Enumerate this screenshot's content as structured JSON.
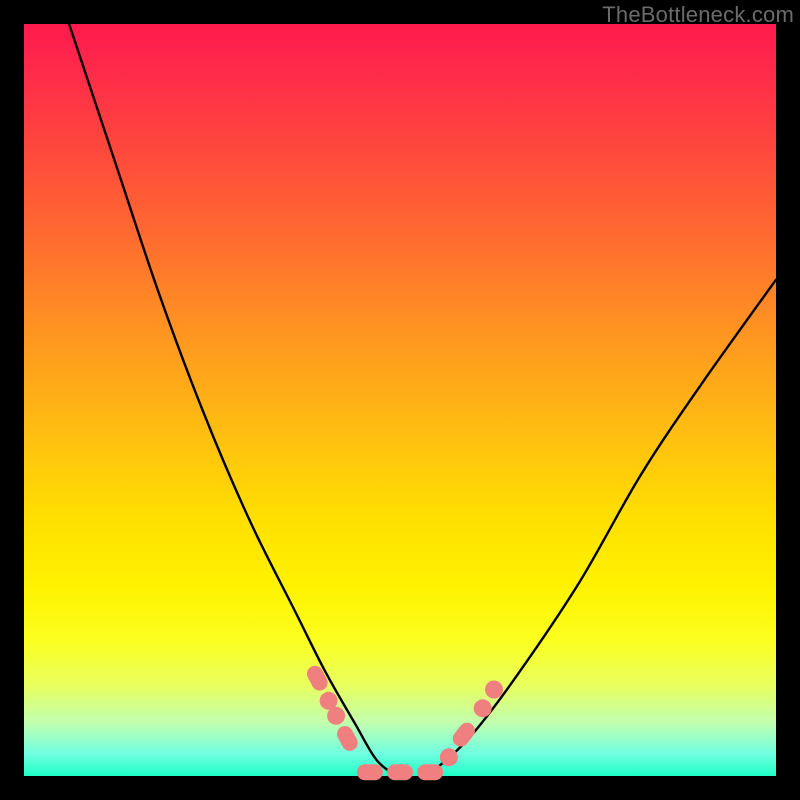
{
  "watermark": "TheBottleneck.com",
  "colors": {
    "background_frame": "#000000",
    "gradient_top": "#ff1a4d",
    "gradient_bottom": "#1effc8",
    "curve_stroke": "#000000",
    "marker_fill": "#f08080"
  },
  "chart_data": {
    "type": "line",
    "title": "",
    "xlabel": "",
    "ylabel": "",
    "xlim": [
      0,
      100
    ],
    "ylim": [
      0,
      100
    ],
    "note": "Axes unlabeled; x and values are in percent of plot area (0-100). Curve is a V-shaped bottleneck curve touching zero near x≈50.",
    "series": [
      {
        "name": "bottleneck-curve",
        "x": [
          6,
          12,
          18,
          24,
          30,
          36,
          40,
          44,
          47,
          50,
          53,
          56,
          60,
          66,
          74,
          82,
          90,
          100
        ],
        "values": [
          100,
          82,
          64,
          48,
          34,
          22,
          14,
          7,
          2,
          0,
          0,
          2,
          6,
          14,
          26,
          40,
          52,
          66
        ]
      }
    ],
    "markers": {
      "note": "Salmon-colored markers near the trough of the curve; positions in percent of plot area.",
      "points": [
        {
          "x": 39,
          "y": 13,
          "shape": "lozenge"
        },
        {
          "x": 40.5,
          "y": 10,
          "shape": "round"
        },
        {
          "x": 41.5,
          "y": 8,
          "shape": "round"
        },
        {
          "x": 43,
          "y": 5,
          "shape": "lozenge"
        },
        {
          "x": 46,
          "y": 0.5,
          "shape": "lozenge"
        },
        {
          "x": 50,
          "y": 0.5,
          "shape": "lozenge"
        },
        {
          "x": 54,
          "y": 0.5,
          "shape": "lozenge"
        },
        {
          "x": 56.5,
          "y": 2.5,
          "shape": "round"
        },
        {
          "x": 58.5,
          "y": 5.5,
          "shape": "lozenge"
        },
        {
          "x": 61,
          "y": 9,
          "shape": "round"
        },
        {
          "x": 62.5,
          "y": 11.5,
          "shape": "round"
        }
      ]
    }
  }
}
